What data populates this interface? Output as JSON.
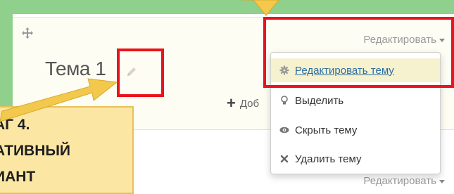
{
  "section": {
    "title": "Тема 1",
    "edit_menu_label": "Редактировать",
    "add_activity_label": "Доб",
    "bottom_edit_menu_label": "Редактировать"
  },
  "dropdown": {
    "items": [
      {
        "label": "Редактировать тему",
        "icon": "gear-icon",
        "active": true
      },
      {
        "label": "Выделить",
        "icon": "lightbulb-icon",
        "active": false
      },
      {
        "label": "Скрыть тему",
        "icon": "eye-icon",
        "active": false
      },
      {
        "label": "Удалить тему",
        "icon": "close-icon",
        "active": false
      }
    ]
  },
  "callout": {
    "lines": [
      "АГ 4.",
      "АТИВНЫЙ",
      "ИАНТ"
    ]
  },
  "colors": {
    "background": "#8fd08c",
    "highlight_red": "#e8141c",
    "callout_fill": "#fce6a4",
    "arrow_gold": "#f2c94c",
    "link_blue": "#2a6ea5"
  }
}
